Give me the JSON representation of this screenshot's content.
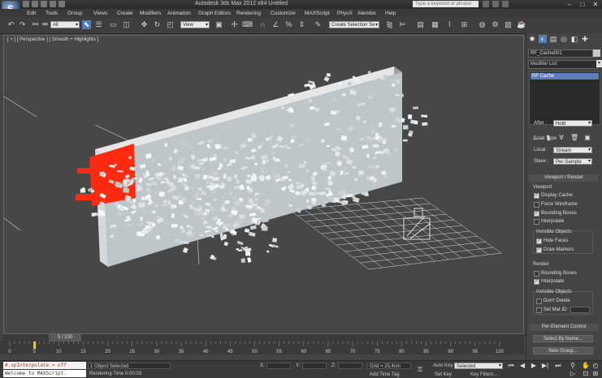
{
  "title": "Autodesk 3ds Max 2012 x64      Untitled",
  "search_placeholder": "Type a keyword or phrase",
  "menu": [
    "Edit",
    "Tools",
    "Group",
    "Views",
    "Create",
    "Modifiers",
    "Animation",
    "Graph Editors",
    "Rendering",
    "Customize",
    "MAXScript",
    "PhysX",
    "Alembic",
    "Help"
  ],
  "toolbar": {
    "filter": "All",
    "ref_coord": "View",
    "named_sel": "Create Selection Se"
  },
  "viewport": {
    "label": "[ + ] [ Perspective ] [ Smooth + Highlights ]",
    "accent_red": "#ff2a10"
  },
  "command_panel": {
    "object_name": "RF_Cache001",
    "modifier_list": "Modifier List",
    "stack_item": "RF Cache",
    "after_label": "After :",
    "after_value": "Hold",
    "load_type": "Load Type",
    "local_label": "Local :",
    "local_value": "Stream",
    "slave_label": "Slave :",
    "slave_value": "Per-Sample",
    "viewport_render": "Viewport / Render",
    "viewport": "Viewport",
    "display_cache": "Display Cache",
    "force_wireframe": "Force Wireframe",
    "bounding_boxes": "Bounding Boxes",
    "interpolate": "Interpolate",
    "invisible_objects": "Invisible Objects",
    "hide_faces": "Hide Faces",
    "draw_markers": "Draw Markers",
    "render": "Render",
    "r_bounding_boxes": "Bounding Boxes",
    "r_interpolate": "Interpolate",
    "r_invisible_objects": "Invisible Objects",
    "dont_delete": "Don't Delete",
    "set_mat_id": "Set Mat ID:",
    "per_element": "Per-Element Control",
    "select_by_name": "Select By Name...",
    "new_group": "New Group..."
  },
  "timeline": {
    "frame": "5 / 100",
    "ticks": [
      "0",
      "5",
      "10",
      "15",
      "20",
      "25",
      "30",
      "35",
      "40",
      "45",
      "50",
      "55",
      "60",
      "65",
      "70",
      "75",
      "80",
      "85",
      "90",
      "95",
      "100"
    ]
  },
  "status": {
    "maxscript_line": "#.vpInterpolate = off",
    "maxscript_welcome": "Welcome to MAXScript.",
    "objects_selected": "1 Object Selected",
    "rendering_time": "Rendering Time  0:00:03",
    "x_label": "X:",
    "y_label": "Y:",
    "z_label": "Z:",
    "grid": "Grid = 25,4cm",
    "add_time_tag": "Add Time Tag",
    "auto_key": "Auto Key",
    "set_key": "Set Key",
    "auto_key_value": "Selected",
    "key_filters": "Key Filters..."
  }
}
